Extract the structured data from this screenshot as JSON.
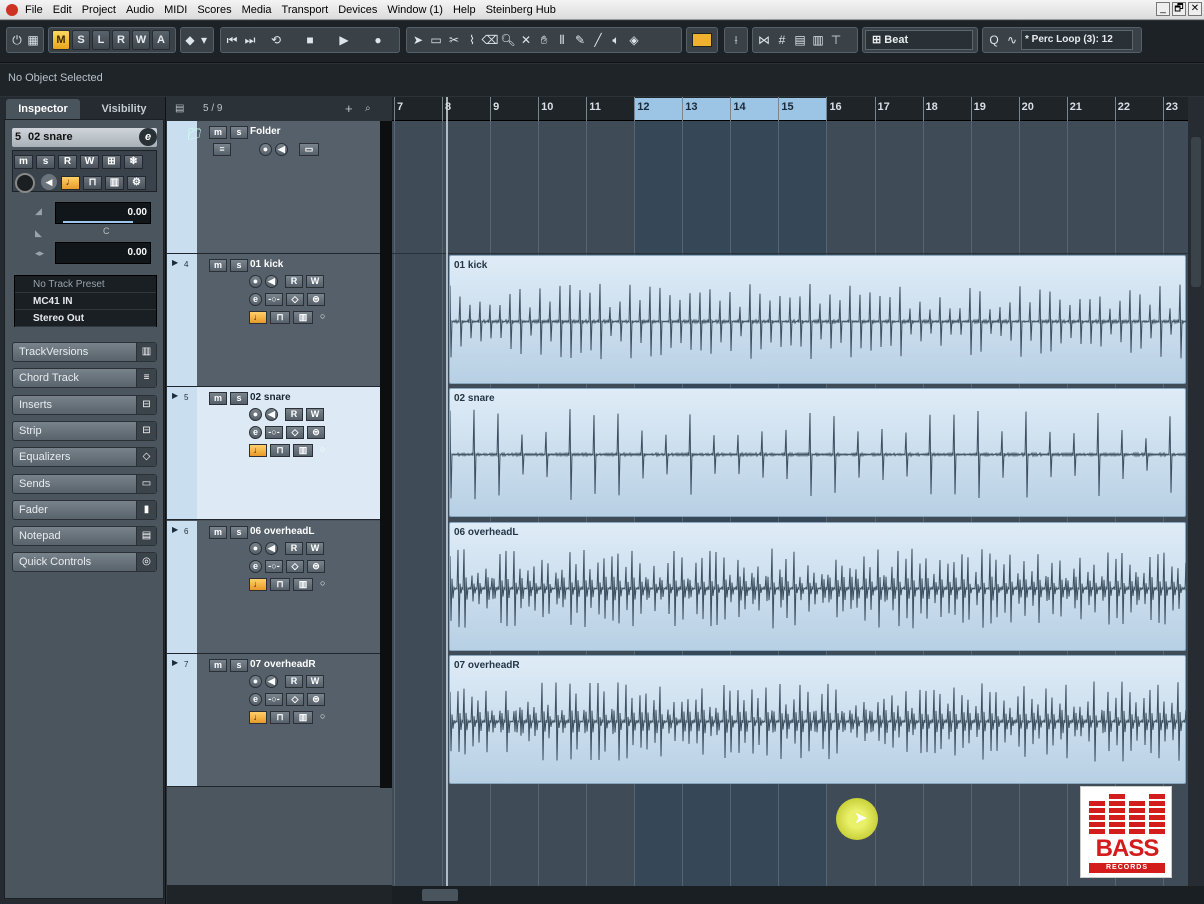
{
  "menu": [
    "File",
    "Edit",
    "Project",
    "Audio",
    "MIDI",
    "Scores",
    "Media",
    "Transport",
    "Devices",
    "Window (1)",
    "Help",
    "Steinberg Hub"
  ],
  "window_controls": [
    "_",
    "🗗",
    "✕"
  ],
  "toolbar": {
    "state_buttons": [
      "M",
      "S",
      "L",
      "R",
      "W",
      "A"
    ],
    "snap_type": "Beat",
    "quantize_label": "Q",
    "preset": "* Perc Loop (3): 12"
  },
  "info_line": "No Object Selected",
  "inspector": {
    "tabs": [
      "Inspector",
      "Visibility"
    ],
    "selected_track": "02 snare",
    "track_number_prefix": "5",
    "volume_value": "0.00",
    "pan_label": "C",
    "pan_value": "0.00",
    "track_preset": "No Track Preset",
    "input": "MC41 IN",
    "output": "Stereo Out",
    "sections": [
      "TrackVersions",
      "Chord Track",
      "Inserts",
      "Strip",
      "Equalizers",
      "Sends",
      "Fader",
      "Notepad",
      "Quick Controls"
    ]
  },
  "tracklist": {
    "counter": "5 / 9",
    "tracks": [
      {
        "num": "",
        "name": "Folder",
        "selected": false
      },
      {
        "num": "4",
        "name": "01 kick",
        "selected": false
      },
      {
        "num": "5",
        "name": "02 snare",
        "selected": true
      },
      {
        "num": "6",
        "name": "06 overheadL",
        "selected": false
      },
      {
        "num": "7",
        "name": "07 overheadR",
        "selected": false
      }
    ],
    "button_labels": {
      "mute": "m",
      "solo": "s",
      "read": "R",
      "write": "W"
    }
  },
  "ruler": {
    "bars": [
      "7",
      "8",
      "9",
      "10",
      "11",
      "12",
      "13",
      "14",
      "15",
      "16",
      "17",
      "18",
      "19",
      "20",
      "21",
      "22",
      "23"
    ],
    "cycle_start_bar": 12,
    "cycle_end_bar": 16
  },
  "events": [
    {
      "name": "01 kick"
    },
    {
      "name": "02 snare"
    },
    {
      "name": "06 overheadL"
    },
    {
      "name": "07 overheadR"
    }
  ],
  "badge": {
    "brand": "BASS",
    "sub": "RECORDS"
  },
  "colors": {
    "accent_yellow": "#f0b030",
    "event_blue": "#c7dcee",
    "selected_track": "#ddeaf5",
    "brand_red": "#d31c1c"
  }
}
